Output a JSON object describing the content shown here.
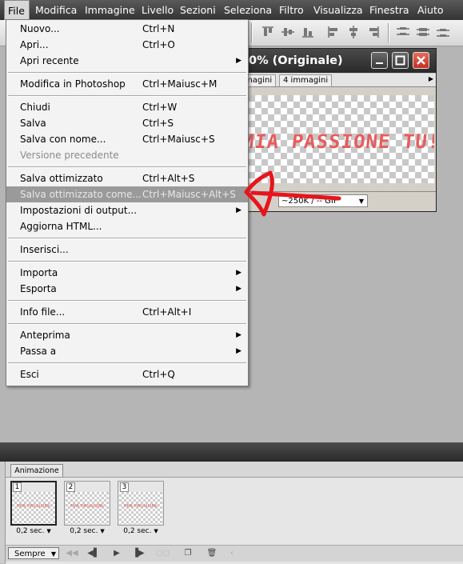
{
  "menubar": {
    "items": [
      "File",
      "Modifica",
      "Immagine",
      "Livello",
      "Sezioni",
      "Seleziona",
      "Filtro",
      "Visualizza",
      "Finestra",
      "Aiuto"
    ]
  },
  "file_menu": {
    "groups": [
      [
        {
          "label": "Nuovo...",
          "shortcut": "Ctrl+N"
        },
        {
          "label": "Apri...",
          "shortcut": "Ctrl+O"
        },
        {
          "label": "Apri recente",
          "shortcut": "",
          "submenu": true
        }
      ],
      [
        {
          "label": "Modifica in Photoshop",
          "shortcut": "Ctrl+Maiusc+M"
        }
      ],
      [
        {
          "label": "Chiudi",
          "shortcut": "Ctrl+W"
        },
        {
          "label": "Salva",
          "shortcut": "Ctrl+S"
        },
        {
          "label": "Salva con nome...",
          "shortcut": "Ctrl+Maiusc+S"
        },
        {
          "label": "Versione precedente",
          "shortcut": "",
          "disabled": true
        }
      ],
      [
        {
          "label": "Salva ottimizzato",
          "shortcut": "Ctrl+Alt+S"
        },
        {
          "label": "Salva ottimizzato come...",
          "shortcut": "Ctrl+Maiusc+Alt+S",
          "highlighted": true
        },
        {
          "label": "Impostazioni di output...",
          "shortcut": "",
          "submenu": true
        },
        {
          "label": "Aggiorna HTML...",
          "shortcut": ""
        }
      ],
      [
        {
          "label": "Inserisci...",
          "shortcut": ""
        }
      ],
      [
        {
          "label": "Importa",
          "shortcut": "",
          "submenu": true
        },
        {
          "label": "Esporta",
          "shortcut": "",
          "submenu": true
        }
      ],
      [
        {
          "label": "Info file...",
          "shortcut": "Ctrl+Alt+I"
        }
      ],
      [
        {
          "label": "Anteprima",
          "shortcut": "",
          "submenu": true
        },
        {
          "label": "Passa a",
          "shortcut": "",
          "submenu": true
        }
      ],
      [
        {
          "label": "Esci",
          "shortcut": "Ctrl+Q"
        }
      ]
    ]
  },
  "document": {
    "title": "0% (Originale)",
    "tabs": [
      "magini",
      "4 immagini"
    ],
    "canvas_text": "MIA PASSIONE TU!",
    "status_select": "~250K / -- GIF"
  },
  "animation": {
    "tab": "Animazione",
    "frames": [
      {
        "num": "1",
        "delay": "0,2 sec.",
        "selected": true
      },
      {
        "num": "2",
        "delay": "0,2 sec.",
        "selected": false
      },
      {
        "num": "3",
        "delay": "0,2 sec.",
        "selected": false
      }
    ],
    "loop": "Sempre"
  },
  "colors": {
    "annotation_arrow": "#e8141c",
    "canvas_text": "#e85c5c",
    "close_button": "#d23a28"
  }
}
